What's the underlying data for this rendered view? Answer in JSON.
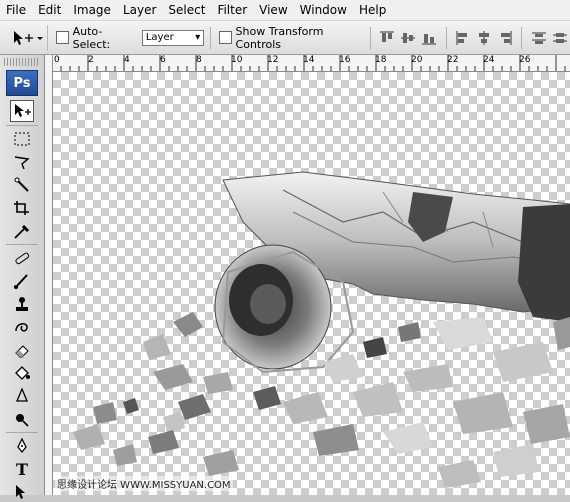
{
  "menu": [
    "File",
    "Edit",
    "Image",
    "Layer",
    "Select",
    "Filter",
    "View",
    "Window",
    "Help"
  ],
  "options": {
    "auto_select_label": "Auto-Select:",
    "auto_select_value": "Layer",
    "show_transform_label": "Show Transform Controls"
  },
  "app_logo": "Ps",
  "ruler": [
    "0",
    "2",
    "4",
    "6",
    "8",
    "10",
    "12",
    "14",
    "16",
    "18",
    "20",
    "22",
    "24",
    "26"
  ],
  "tools": [
    "move-tool",
    "marquee-tool",
    "lasso-tool",
    "quick-selection-tool",
    "crop-tool",
    "eyedropper-tool",
    "healing-brush-tool",
    "brush-tool",
    "clone-stamp-tool",
    "history-brush-tool",
    "eraser-tool",
    "paint-bucket-tool",
    "blur-tool",
    "dodge-tool",
    "pen-tool",
    "type-tool",
    "path-selection-tool"
  ],
  "watermark": "思缘设计论坛 WWW.MISSYUAN.COM"
}
